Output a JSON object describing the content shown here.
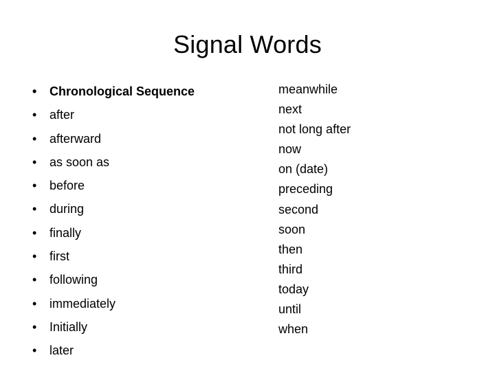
{
  "slide": {
    "title": "Signal Words",
    "background_color": "#ffffff",
    "text_color": "#000000",
    "bullet_glyph": "•",
    "left_column": {
      "bulleted": true,
      "items": [
        {
          "text": "Chronological Sequence",
          "bold": true
        },
        {
          "text": "after",
          "bold": false
        },
        {
          "text": "afterward",
          "bold": false
        },
        {
          "text": "as soon as",
          "bold": false
        },
        {
          "text": "before",
          "bold": false
        },
        {
          "text": "during",
          "bold": false
        },
        {
          "text": "finally",
          "bold": false
        },
        {
          "text": "first",
          "bold": false
        },
        {
          "text": "following",
          "bold": false
        },
        {
          "text": "immediately",
          "bold": false
        },
        {
          "text": "Initially",
          "bold": false
        },
        {
          "text": "later",
          "bold": false
        }
      ]
    },
    "right_column": {
      "bulleted": false,
      "items": [
        {
          "text": "meanwhile"
        },
        {
          "text": "next"
        },
        {
          "text": "not long after"
        },
        {
          "text": "now"
        },
        {
          "text": "on (date)"
        },
        {
          "text": "preceding"
        },
        {
          "text": "second"
        },
        {
          "text": "soon"
        },
        {
          "text": "then"
        },
        {
          "text": "third"
        },
        {
          "text": "today"
        },
        {
          "text": "until"
        },
        {
          "text": "when"
        }
      ]
    }
  }
}
